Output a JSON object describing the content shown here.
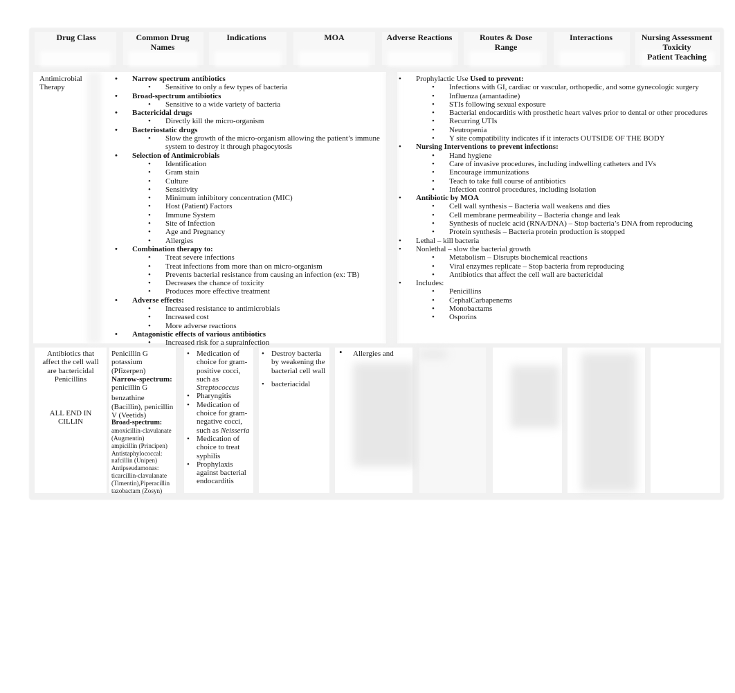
{
  "headers": [
    "Drug Class",
    "Common Drug Names",
    "Indications",
    "MOA",
    "Adverse Reactions",
    "Routes & Dose Range",
    "Interactions",
    "Nursing Assessment Toxicity Patient Teaching"
  ],
  "header_lines": {
    "common_drug_names": [
      "Common Drug",
      "Names"
    ],
    "routes": [
      "Routes & Dose",
      "Range"
    ],
    "nursing": [
      "Nursing Assessment",
      "Toxicity",
      "Patient Teaching"
    ]
  },
  "row1": {
    "drug_class": [
      "Antimicrobial",
      "Therapy"
    ],
    "left_list": [
      {
        "label": "Narrow spectrum antibiotics",
        "bold": true,
        "children": [
          "Sensitive to only a few types of bacteria"
        ]
      },
      {
        "label": "Broad-spectrum antibiotics",
        "bold": true,
        "children": [
          "Sensitive to a wide variety of bacteria"
        ]
      },
      {
        "label": "Bactericidal drugs",
        "bold": true,
        "children": [
          "Directly kill the micro-organism"
        ]
      },
      {
        "label": "Bacteriostatic drugs",
        "bold": true,
        "children": [
          "Slow the growth of the micro-organism allowing the patient’s immune system to destroy it through phagocytosis"
        ]
      },
      {
        "label": "Selection of Antimicrobials",
        "bold": true,
        "children": [
          "Identification",
          "Gram stain",
          "Culture",
          "Sensitivity",
          "Minimum inhibitory concentration (MIC)",
          "Host (Patient) Factors",
          "Immune System",
          "Site of Infection",
          "Age and Pregnancy",
          "Allergies"
        ]
      },
      {
        "label": "Combination therapy to:",
        "bold": true,
        "children": [
          "Treat severe infections",
          "Treat infections from more than on micro-organism",
          "Prevents bacterial resistance from causing an infection (ex: TB)",
          "Decreases the chance of toxicity",
          "Produces more effective treatment"
        ]
      },
      {
        "label": "Adverse effects:",
        "bold": true,
        "children": [
          "Increased resistance to antimicrobials",
          "Increased cost",
          "More adverse reactions"
        ]
      },
      {
        "label": "Antagonistic effects of various antibiotics",
        "bold": true,
        "children": [
          "Increased risk for a suprainfection"
        ]
      }
    ],
    "right_list": [
      {
        "label_plain": "Prophylactic Use ",
        "label_bold": "Used to prevent:",
        "children": [
          "Infections with GI, cardiac or vascular, orthopedic, and some gynecologic surgery",
          "Influenza (amantadine)",
          "STIs following sexual exposure",
          "Bacterial endocarditis with prosthetic heart valves prior to dental or other procedures",
          "Recurring UTIs",
          "Neutropenia",
          "Y site compatibility indicates if it interacts OUTSIDE OF THE BODY"
        ]
      },
      {
        "label_plain": "",
        "label_bold": "Nursing Interventions to prevent infections:",
        "children": [
          "Hand hygiene",
          "Care of invasive procedures, including indwelling catheters and IVs",
          "Encourage immunizations",
          "Teach to take full course of antibiotics",
          "Infection control procedures, including isolation"
        ]
      },
      {
        "label_plain": "",
        "label_bold": "Antibiotic by MOA",
        "children": [
          "Cell wall synthesis – Bacteria wall weakens and dies",
          "Cell membrane permeability – Bacteria change and leak",
          "Synthesis of nucleic acid (RNA/DNA) – Stop bacteria’s DNA from reproducing",
          "Protein synthesis – Bacteria protein production is stopped"
        ]
      },
      {
        "label_plain": "Lethal – kill bacteria",
        "label_bold": "",
        "children": []
      },
      {
        "label_plain": "Nonlethal – slow the bacterial growth",
        "label_bold": "",
        "children": [
          "Metabolism – Disrupts biochemical reactions",
          "Viral enzymes replicate – Stop bacteria from reproducing",
          "Antibiotics that affect the cell wall are bactericidal"
        ]
      },
      {
        "label_plain": "Includes:",
        "label_bold": "",
        "children": [
          "Penicillins",
          "CephalCarbapenems",
          "Monobactams",
          "Osporins"
        ]
      }
    ]
  },
  "row2": {
    "drug_class": [
      "Antibiotics that",
      "affect the cell wall",
      "are bactericidal",
      "Penicillins"
    ],
    "drug_class_note": [
      "ALL END IN",
      "CILLIN"
    ],
    "drug_names": {
      "intro": [
        "Penicillin G",
        "potassium",
        "(Pfizerpen)"
      ],
      "narrow_label": "Narrow-spectrum:",
      "narrow": [
        "penicillin G",
        "benzathine",
        "(Bacillin), penicillin",
        "V (Veetids)"
      ],
      "broad_label": "Broad-spectrum:",
      "broad": [
        "amoxicillin-clavulanate",
        "(Augmentin)",
        "ampicillin (Principen)",
        "Antistaphylococcal:",
        "nafcillin (Unipen)",
        "Antipseudamonas:",
        "ticarcillin-clavulanate",
        "(Timentin),Piperacillin",
        "tazobactam (Zosyn)"
      ]
    },
    "indications": [
      {
        "text": "Medication of choice for gram-positive cocci, such as ",
        "italic": "Streptococcus"
      },
      {
        "text": "Pharyngitis",
        "italic": ""
      },
      {
        "text": "Medication of choice for gram-negative cocci, such as ",
        "italic": "Neisseria"
      },
      {
        "text": "Medication of choice to treat syphilis",
        "italic": ""
      },
      {
        "text": "Prophylaxis against bacterial endocarditis",
        "italic": ""
      }
    ],
    "moa": [
      "Destroy bacteria by weakening the bacterial cell wall",
      "bacteriacidal"
    ],
    "adverse_reactions_visible": "Allergies and"
  }
}
